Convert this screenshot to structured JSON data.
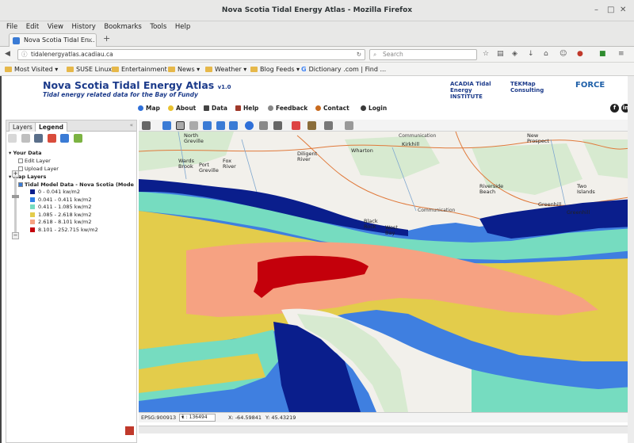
{
  "window": {
    "title": "Nova Scotia Tidal Energy Atlas - Mozilla Firefox"
  },
  "menu": [
    "File",
    "Edit",
    "View",
    "History",
    "Bookmarks",
    "Tools",
    "Help"
  ],
  "tab": {
    "label": "Nova Scotia Tidal En..."
  },
  "nav": {
    "url": "tidalenergyatlas.acadiau.ca",
    "search_placeholder": "Search"
  },
  "bookmarks": [
    "Most Visited",
    "SUSE Linux",
    "Entertainment",
    "News",
    "Weather",
    "Blog Feeds",
    "Dictionary .com | Find ..."
  ],
  "site": {
    "title": "Nova Scotia Tidal Energy Atlas",
    "version": "v1.0",
    "subtitle": "Tidal energy related data for the Bay of Fundy",
    "logos": [
      "ACADIA Tidal Energy INSTITUTE",
      "TEKMap Consulting",
      "FORCE"
    ]
  },
  "topnav": [
    "Map",
    "About",
    "Data",
    "Help",
    "Feedback",
    "Contact",
    "Login"
  ],
  "social": [
    "f",
    "in"
  ],
  "panel": {
    "tabs": [
      "Layers",
      "Legend"
    ],
    "your_data": "Your Data",
    "edit_layer": "Edit Layer",
    "upload_layer": "Upload Layer",
    "map_layers": "Map Layers",
    "layer_name": "Tidal Model Data - Nova Scotia (ModelMeanPowe",
    "legend": [
      {
        "label": "0 - 0.041 kw/m2",
        "color": "#0a1e8c"
      },
      {
        "label": "0.041 - 0.411 kw/m2",
        "color": "#2f7fe6"
      },
      {
        "label": "0.411 - 1.085 kw/m2",
        "color": "#76dcc0"
      },
      {
        "label": "1.085 - 2.618 kw/m2",
        "color": "#e3cc4b"
      },
      {
        "label": "2.618 - 8.101 kw/m2",
        "color": "#f6a282"
      },
      {
        "label": "8.101 - 252.715 kw/m2",
        "color": "#c4000b"
      }
    ]
  },
  "map": {
    "places": [
      "North",
      "Greville",
      "Wards",
      "Brook",
      "Port",
      "Greville",
      "Fox",
      "River",
      "Diligent",
      "River",
      "Wharton",
      "Kirkhill",
      "Communication",
      "New",
      "Prospect",
      "Riverside",
      "Beach",
      "Two",
      "Islands",
      "Greenhill",
      "Greenhill",
      "Black",
      "Rock",
      "West",
      "Bay",
      "Communication"
    ],
    "ocean_color": "#3f7fe0"
  },
  "status": {
    "epsg": "EPSG:900913",
    "scale": "1 : 136494",
    "x": "X: -64.59841",
    "y": "Y: 45.43219"
  }
}
